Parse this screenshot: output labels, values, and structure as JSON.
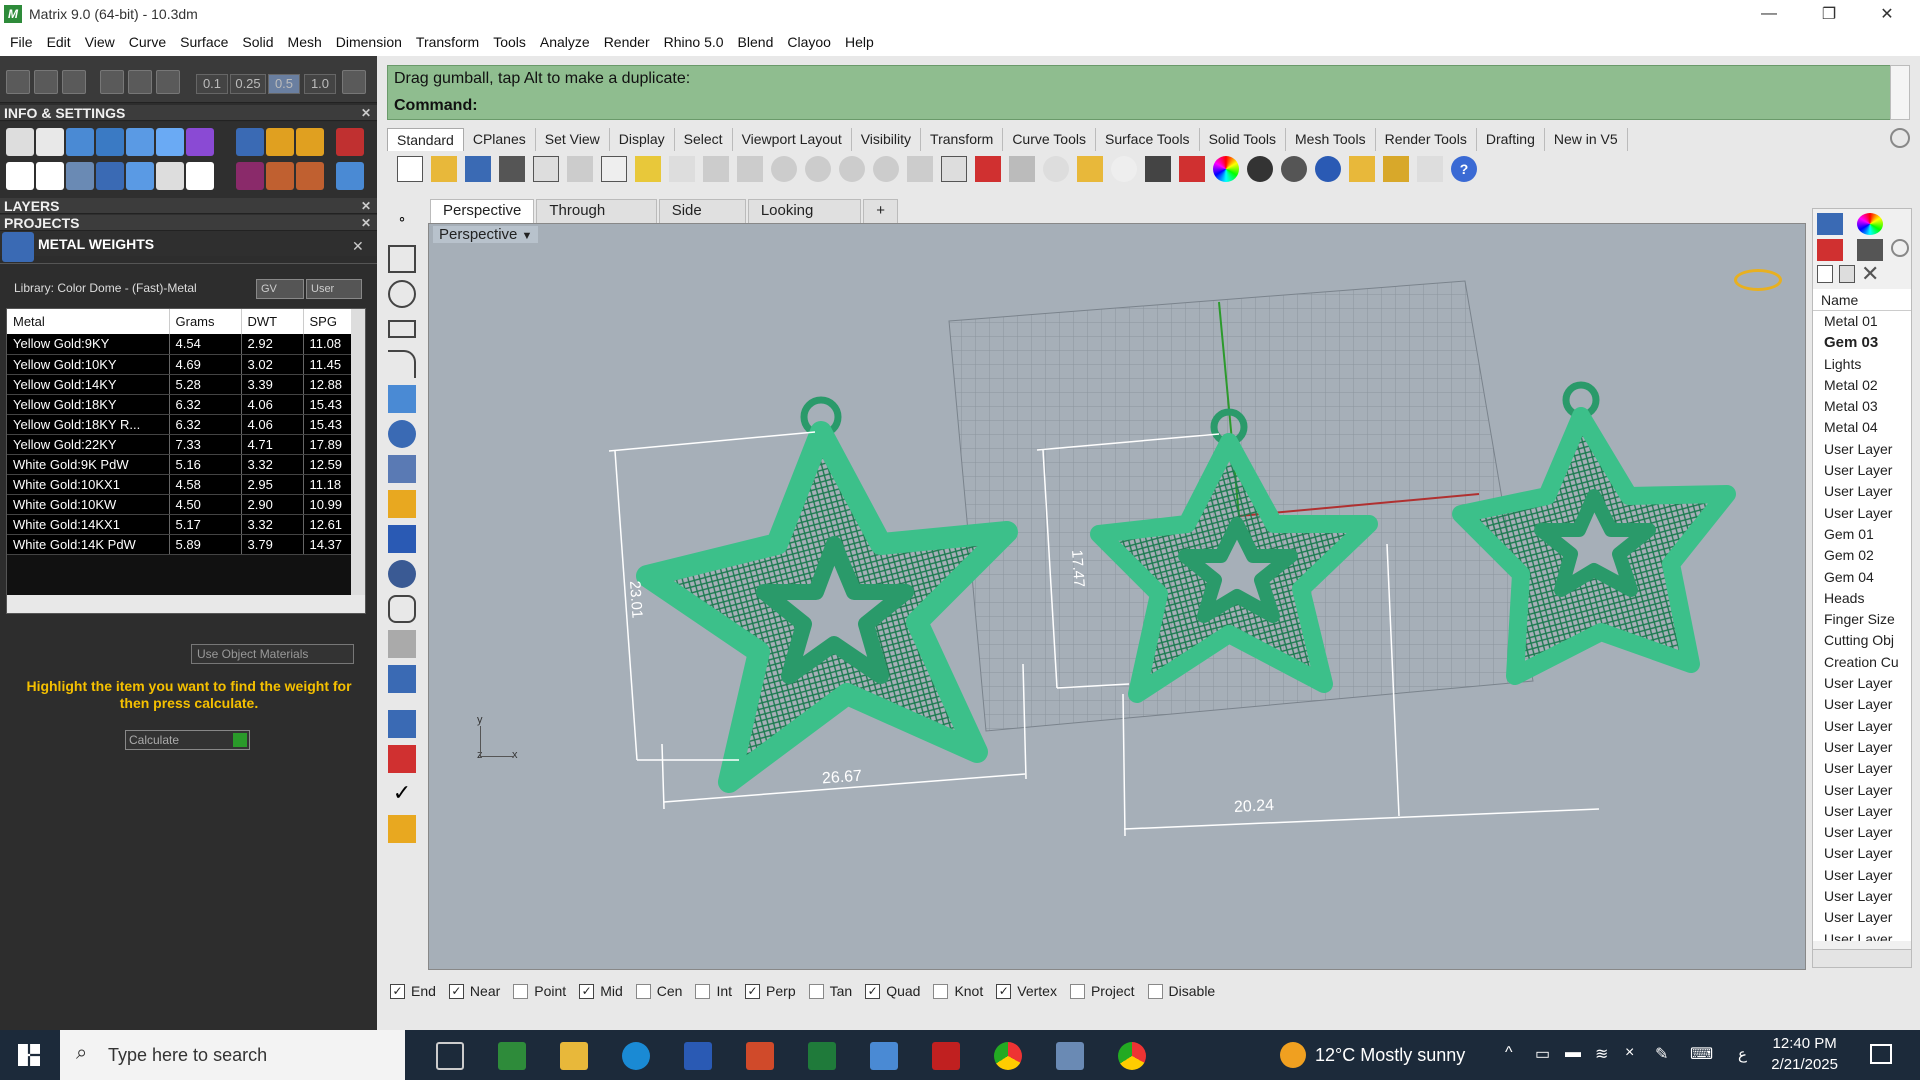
{
  "window": {
    "title": "Matrix 9.0 (64-bit) - 10.3dm",
    "min": "—",
    "restore": "❐",
    "close": "✕"
  },
  "menu": [
    "File",
    "Edit",
    "View",
    "Curve",
    "Surface",
    "Solid",
    "Mesh",
    "Dimension",
    "Transform",
    "Tools",
    "Analyze",
    "Render",
    "Rhino 5.0",
    "Blend",
    "Clayoo",
    "Help"
  ],
  "left_panel": {
    "segments": [
      "0.1",
      "0.25",
      "0.5",
      "1.0"
    ],
    "info_settings": "INFO & SETTINGS",
    "layers": "LAYERS",
    "projects": "PROJECTS",
    "metal_weights": "METAL WEIGHTS",
    "library": "Library: Color Dome - (Fast)-Metal",
    "gv": "GV",
    "user": "User",
    "table": {
      "headers": [
        "Metal",
        "Grams",
        "DWT",
        "SPG"
      ],
      "rows": [
        [
          "Yellow Gold:9KY",
          "4.54",
          "2.92",
          "11.08"
        ],
        [
          "Yellow Gold:10KY",
          "4.69",
          "3.02",
          "11.45"
        ],
        [
          "Yellow Gold:14KY",
          "5.28",
          "3.39",
          "12.88"
        ],
        [
          "Yellow Gold:18KY",
          "6.32",
          "4.06",
          "15.43"
        ],
        [
          "Yellow Gold:18KY R...",
          "6.32",
          "4.06",
          "15.43"
        ],
        [
          "Yellow Gold:22KY",
          "7.33",
          "4.71",
          "17.89"
        ],
        [
          "White Gold:9K PdW",
          "5.16",
          "3.32",
          "12.59"
        ],
        [
          "White Gold:10KX1",
          "4.58",
          "2.95",
          "11.18"
        ],
        [
          "White Gold:10KW",
          "4.50",
          "2.90",
          "10.99"
        ],
        [
          "White Gold:14KX1",
          "5.17",
          "3.32",
          "12.61"
        ],
        [
          "White Gold:14K PdW",
          "5.89",
          "3.79",
          "14.37"
        ]
      ]
    },
    "use_object_materials": "Use Object Materials",
    "highlight_msg": "Highlight the item you want to find the weight for then press calculate.",
    "calculate": "Calculate"
  },
  "command": {
    "line1": "Drag gumball, tap Alt to make a duplicate:",
    "line2": "Command:"
  },
  "toolbar_tabs": [
    "Standard",
    "CPlanes",
    "Set View",
    "Display",
    "Select",
    "Viewport Layout",
    "Visibility",
    "Transform",
    "Curve Tools",
    "Surface Tools",
    "Solid Tools",
    "Mesh Tools",
    "Render Tools",
    "Drafting",
    "New in V5"
  ],
  "viewport_tabs": [
    "Perspective",
    "Through Finger",
    "Side View",
    "Looking Down",
    "+"
  ],
  "viewport_label": "Perspective",
  "dimensions": [
    "23.01",
    "26.67",
    "17.47",
    "20.24"
  ],
  "axis": {
    "y": "y",
    "z": "z",
    "x": "x"
  },
  "layers_panel": {
    "header": "Name",
    "items": [
      "Metal 01",
      "Gem 03",
      "Lights",
      "Metal 02",
      "Metal 03",
      "Metal 04",
      "User Layer",
      "User Layer",
      "User Layer",
      "User Layer",
      "Gem 01",
      "Gem 02",
      "Gem 04",
      "Heads",
      "Finger Size",
      "Cutting Obj",
      "Creation Cu",
      "User Layer",
      "User Layer",
      "User Layer",
      "User Layer",
      "User Layer",
      "User Layer",
      "User Layer",
      "User Layer",
      "User Layer",
      "User Layer",
      "User Layer",
      "User Layer",
      "User Layer"
    ]
  },
  "snaps": [
    {
      "label": "End",
      "checked": true
    },
    {
      "label": "Near",
      "checked": true
    },
    {
      "label": "Point",
      "checked": false
    },
    {
      "label": "Mid",
      "checked": true
    },
    {
      "label": "Cen",
      "checked": false
    },
    {
      "label": "Int",
      "checked": false
    },
    {
      "label": "Perp",
      "checked": true
    },
    {
      "label": "Tan",
      "checked": false
    },
    {
      "label": "Quad",
      "checked": true
    },
    {
      "label": "Knot",
      "checked": false
    },
    {
      "label": "Vertex",
      "checked": true
    },
    {
      "label": "Project",
      "checked": false
    },
    {
      "label": "Disable",
      "checked": false
    }
  ],
  "taskbar": {
    "search": "Type here to search",
    "weather": "12°C  Mostly sunny",
    "lang": "ﻉ",
    "time": "12:40 PM",
    "date": "2/21/2025"
  },
  "colors": {
    "accent_green": "#8fbd8f",
    "model_green": "#1f8a5a",
    "highlight_yellow": "#f5c000"
  }
}
